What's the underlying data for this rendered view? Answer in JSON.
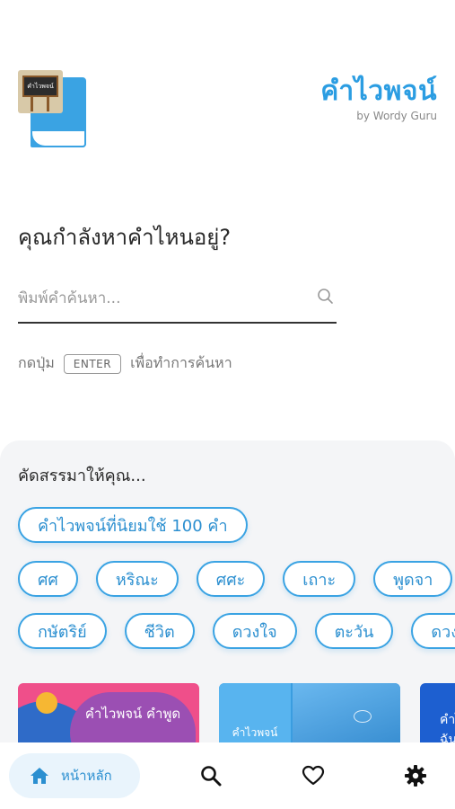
{
  "header": {
    "title": "คำไวพจน์",
    "subtitle": "by Wordy Guru",
    "logo_text": "คำไวพจน์"
  },
  "search": {
    "question": "คุณกำลังหาคำไหนอยู่?",
    "placeholder": "พิมพ์คำค้นหา...",
    "hint_prefix": "กดปุ่ม",
    "hint_key": "ENTER",
    "hint_suffix": "เพื่อทำการค้นหา"
  },
  "recommend": {
    "title": "คัดสรรมาให้คุณ...",
    "featured": "คำไวพจน์ที่นิยมใช้ 100 คำ",
    "row2": [
      "ศศ",
      "หริณะ",
      "ศศะ",
      "เถาะ",
      "พูดจา"
    ],
    "row3": [
      "กษัตริย์",
      "ชีวิต",
      "ดวงใจ",
      "ตะวัน",
      "ดวง"
    ],
    "cards": [
      {
        "title": "คำไวพจน์ คำพูด"
      },
      {
        "title": "คำไวพจน์"
      },
      {
        "title": "คำไ ฉัน"
      }
    ]
  },
  "nav": {
    "home_label": "หน้าหลัก",
    "accent": "#2b8fd0"
  }
}
